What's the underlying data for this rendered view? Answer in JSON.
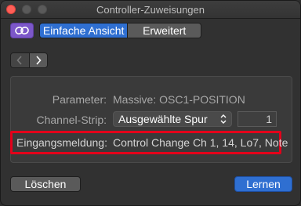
{
  "window": {
    "title": "Controller-Zuweisungen"
  },
  "toolbar": {
    "link_icon": "link-icon",
    "view_tabs": [
      {
        "label": "Einfache Ansicht",
        "active": true
      },
      {
        "label": "Erweitert",
        "active": false
      }
    ]
  },
  "nav": {
    "prev_icon": "chevron-left-icon",
    "next_icon": "chevron-right-icon"
  },
  "panel": {
    "parameter_label": "Parameter:",
    "parameter_value": "Massive: OSC1-POSITION",
    "channel_strip_label": "Channel-Strip:",
    "channel_strip_value": "Ausgewählte Spur",
    "channel_number": "1",
    "input_label": "Eingangsmeldung:",
    "input_value": "Control Change Ch 1, 14, Lo7, Note"
  },
  "footer": {
    "delete_label": "Löschen",
    "learn_label": "Lernen"
  },
  "colors": {
    "accent": "#2f6fd1",
    "link_button": "#7c57c9",
    "highlight": "#e3001a"
  }
}
